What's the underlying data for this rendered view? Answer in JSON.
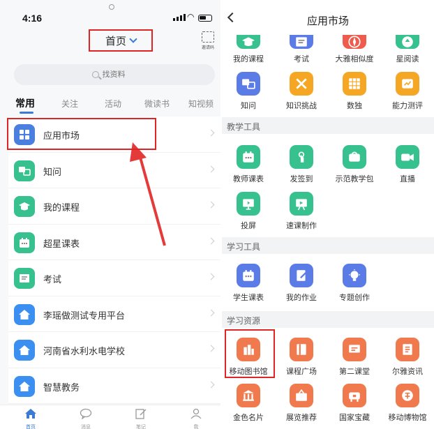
{
  "left": {
    "status": {
      "time": "4:16"
    },
    "header": {
      "title": "首页",
      "scan_label": "邀请码"
    },
    "search": {
      "placeholder": "找资料"
    },
    "tabs": [
      "常用",
      "关注",
      "活动",
      "微读书",
      "知视频"
    ],
    "list": [
      {
        "label": "应用市场",
        "icon": "grid-icon",
        "color": "#4a7fe0"
      },
      {
        "label": "知问",
        "icon": "qa-icon",
        "color": "#36c18e"
      },
      {
        "label": "我的课程",
        "icon": "graduation-cap-icon",
        "color": "#36c18e"
      },
      {
        "label": "超星课表",
        "icon": "calendar-icon",
        "color": "#36c18e"
      },
      {
        "label": "考试",
        "icon": "exam-icon",
        "color": "#36c18e"
      },
      {
        "label": "李瑶做测试专用平台",
        "icon": "home-icon",
        "color": "#3b8ff0"
      },
      {
        "label": "河南省水利水电学校",
        "icon": "home-icon",
        "color": "#3b8ff0"
      },
      {
        "label": "智慧教务",
        "icon": "home-icon",
        "color": "#3b8ff0"
      }
    ],
    "bottom_nav": [
      "首页",
      "消息",
      "笔记",
      "我"
    ]
  },
  "right": {
    "title": "应用市场",
    "top_apps": [
      {
        "label": "我的课程",
        "color": "#36c18e",
        "icon": "graduation-cap-icon"
      },
      {
        "label": "考试",
        "color": "#5b7ce6",
        "icon": "exam-icon"
      },
      {
        "label": "大雅相似度",
        "color": "#ef5b4c",
        "icon": "compass-icon"
      },
      {
        "label": "星阅读",
        "color": "#36c18e",
        "icon": "star-read-icon"
      }
    ],
    "row2_apps": [
      {
        "label": "知问",
        "color": "#5b7ce6",
        "icon": "qa-icon"
      },
      {
        "label": "知识挑战",
        "color": "#f5a623",
        "icon": "crossed-swords-icon"
      },
      {
        "label": "数独",
        "color": "#f5a623",
        "icon": "sudoku-icon"
      },
      {
        "label": "能力测评",
        "color": "#f5a623",
        "icon": "assessment-icon"
      }
    ],
    "sections": [
      {
        "title": "教学工具",
        "apps": [
          {
            "label": "教师课表",
            "color": "#36c18e",
            "icon": "calendar-icon"
          },
          {
            "label": "发签到",
            "color": "#36c18e",
            "icon": "tap-icon"
          },
          {
            "label": "示范教学包",
            "color": "#36c18e",
            "icon": "package-icon"
          },
          {
            "label": "直播",
            "color": "#36c18e",
            "icon": "video-icon"
          },
          {
            "label": "投屏",
            "color": "#36c18e",
            "icon": "screen-icon"
          },
          {
            "label": "速课制作",
            "color": "#36c18e",
            "icon": "slides-icon"
          }
        ]
      },
      {
        "title": "学习工具",
        "apps": [
          {
            "label": "学生课表",
            "color": "#5b7ce6",
            "icon": "calendar-icon"
          },
          {
            "label": "我的作业",
            "color": "#5b7ce6",
            "icon": "homework-icon"
          },
          {
            "label": "专题创作",
            "color": "#5b7ce6",
            "icon": "lightbulb-icon"
          }
        ]
      },
      {
        "title": "学习资源",
        "apps": [
          {
            "label": "移动图书馆",
            "color": "#f07a4e",
            "icon": "library-icon"
          },
          {
            "label": "课程广场",
            "color": "#f07a4e",
            "icon": "book-icon"
          },
          {
            "label": "第二课堂",
            "color": "#f07a4e",
            "icon": "classroom-icon"
          },
          {
            "label": "尔雅资讯",
            "color": "#f07a4e",
            "icon": "news-icon"
          },
          {
            "label": "金色名片",
            "color": "#f07a4e",
            "icon": "museum-icon"
          },
          {
            "label": "展览推荐",
            "color": "#f07a4e",
            "icon": "exhibit-icon"
          },
          {
            "label": "国家宝藏",
            "color": "#f07a4e",
            "icon": "treasure-icon"
          },
          {
            "label": "移动博物馆",
            "color": "#f07a4e",
            "icon": "museum-seal-icon"
          }
        ]
      }
    ]
  }
}
